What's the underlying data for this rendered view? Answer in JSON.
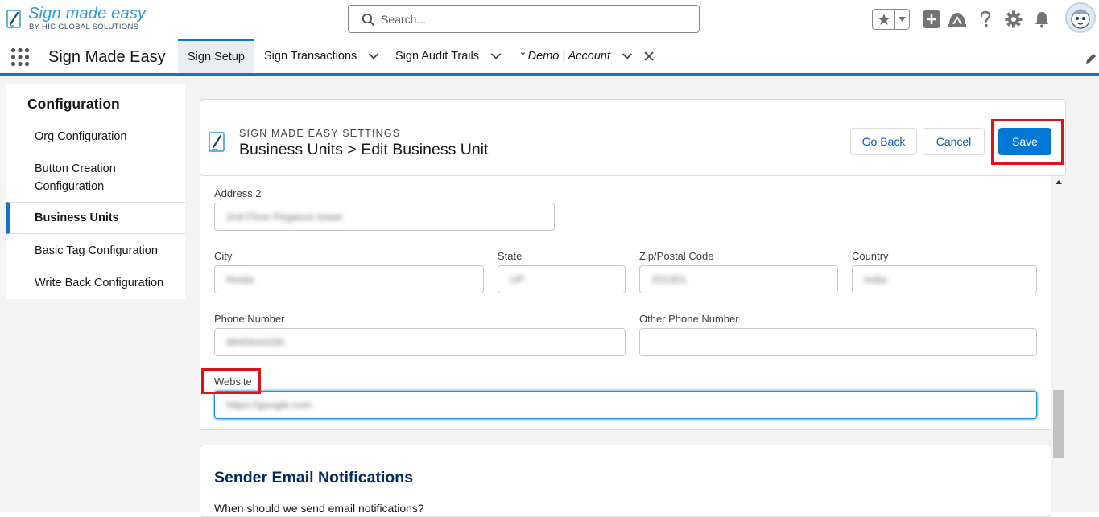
{
  "brand": {
    "logo_title": "Sign made easy",
    "logo_subtitle": "BY HIC GLOBAL SOLUTIONS",
    "accent": "#1b72c2",
    "brand_button": "#0176d3"
  },
  "search": {
    "placeholder": "Search..."
  },
  "header_icons": [
    "favorites-star-icon",
    "favorites-menu-caret-icon",
    "global-actions-plus-icon",
    "trailhead-icon",
    "help-icon",
    "setup-gear-icon",
    "notifications-bell-icon",
    "user-avatar"
  ],
  "app_nav": {
    "app_name": "Sign Made Easy",
    "tabs": [
      {
        "label": "Sign Setup",
        "active": true
      },
      {
        "label": "Sign Transactions",
        "has_menu": true
      },
      {
        "label": "Sign Audit Trails",
        "has_menu": true
      },
      {
        "label": "* Demo | Account",
        "has_menu": true,
        "closable": true,
        "italic": true
      }
    ]
  },
  "sidebar": {
    "heading": "Configuration",
    "items": [
      {
        "label": "Org Configuration"
      },
      {
        "label": "Button Creation Configuration"
      },
      {
        "label": "Business Units",
        "active": true
      },
      {
        "label": "Basic Tag Configuration"
      },
      {
        "label": "Write Back Configuration"
      }
    ]
  },
  "page_header": {
    "eyebrow": "SIGN MADE EASY SETTINGS",
    "title": "Business Units > Edit Business Unit",
    "go_back_label": "Go Back",
    "cancel_label": "Cancel",
    "save_label": "Save"
  },
  "form": {
    "address2": {
      "label": "Address 2",
      "value": "2nd Floor Pegasus tower"
    },
    "city": {
      "label": "City",
      "value": "Noida"
    },
    "state": {
      "label": "State",
      "value": "UP"
    },
    "zip": {
      "label": "Zip/Postal Code",
      "value": "201301"
    },
    "country": {
      "label": "Country",
      "value": "India"
    },
    "phone": {
      "label": "Phone Number",
      "value": "9845644330"
    },
    "other_phone": {
      "label": "Other Phone Number",
      "value": ""
    },
    "website": {
      "label": "Website",
      "value": "https://google.com"
    }
  },
  "email_section": {
    "title": "Sender Email Notifications",
    "question": "When should we send email notifications?"
  }
}
